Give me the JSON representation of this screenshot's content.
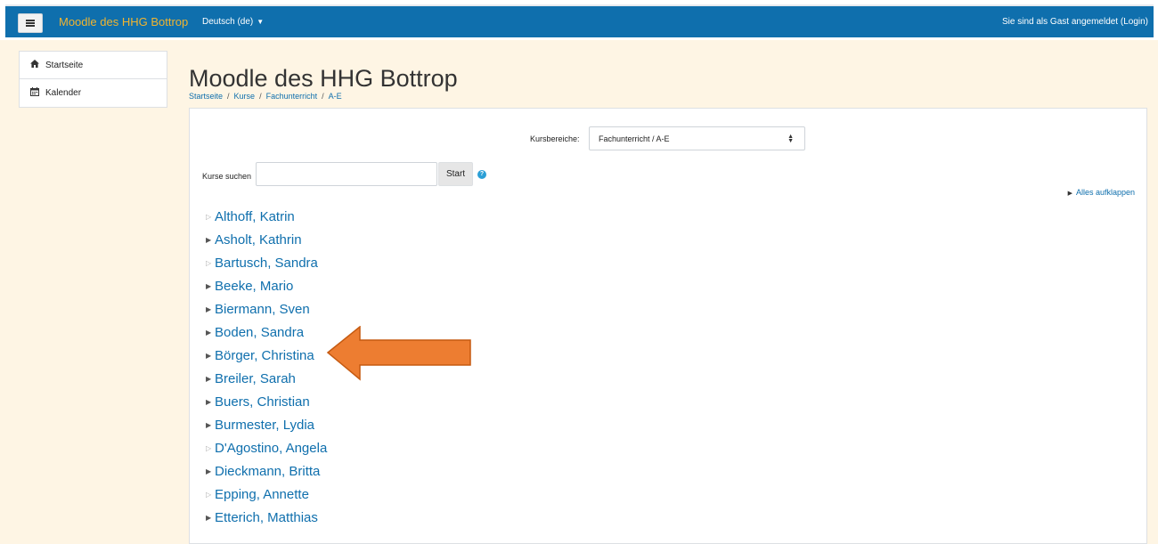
{
  "navbar": {
    "brand": "Moodle des HHG Bottrop",
    "language": "Deutsch (de)",
    "login_text": "Sie sind als Gast angemeldet (Login)",
    "bg_color": "#0f6fad",
    "brand_color": "#f1b42f"
  },
  "sidebar": {
    "items": [
      {
        "label": "Startseite",
        "icon": "home-icon"
      },
      {
        "label": "Kalender",
        "icon": "calendar-icon"
      }
    ]
  },
  "page": {
    "title": "Moodle des HHG Bottrop",
    "breadcrumb": [
      "Startseite",
      "Kurse",
      "Fachunterricht",
      "A-E"
    ]
  },
  "category_select": {
    "label": "Kursbereiche:",
    "value": "Fachunterricht / A-E"
  },
  "search": {
    "label": "Kurse suchen",
    "value": "",
    "button": "Start"
  },
  "expand_all": "Alles aufklappen",
  "categories": [
    {
      "name": "Althoff, Katrin",
      "expandable": false
    },
    {
      "name": "Asholt, Kathrin",
      "expandable": true
    },
    {
      "name": "Bartusch, Sandra",
      "expandable": false
    },
    {
      "name": "Beeke, Mario",
      "expandable": true
    },
    {
      "name": "Biermann, Sven",
      "expandable": true
    },
    {
      "name": "Boden, Sandra",
      "expandable": true
    },
    {
      "name": "Börger, Christina",
      "expandable": true
    },
    {
      "name": "Breiler, Sarah",
      "expandable": true
    },
    {
      "name": "Buers, Christian",
      "expandable": true
    },
    {
      "name": "Burmester, Lydia",
      "expandable": true
    },
    {
      "name": "D'Agostino, Angela",
      "expandable": false
    },
    {
      "name": "Dieckmann, Britta",
      "expandable": true
    },
    {
      "name": "Epping, Annette",
      "expandable": false
    },
    {
      "name": "Etterich, Matthias",
      "expandable": true
    }
  ],
  "annotation": {
    "arrow_color": "#ed7d31",
    "points_to": "Börger, Christina"
  }
}
